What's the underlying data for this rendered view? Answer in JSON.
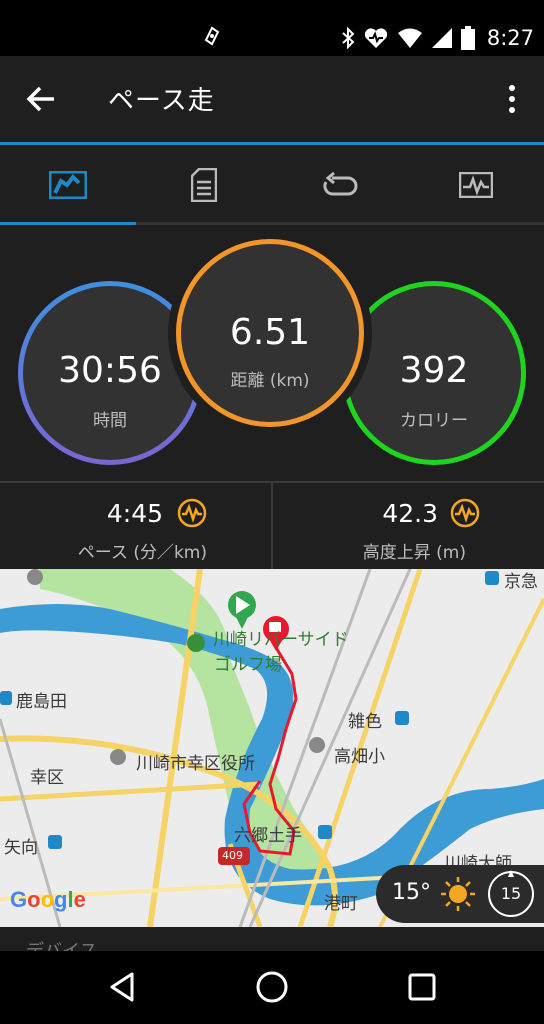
{
  "status_bar": {
    "time": "8:27",
    "icons": [
      "nfc-icon",
      "bluetooth-icon",
      "heart-monitor-icon",
      "wifi-icon",
      "cell-signal-icon",
      "battery-icon"
    ]
  },
  "app_bar": {
    "title": "ペース走",
    "back_icon": "arrow-left-icon",
    "menu_icon": "more-vert-icon"
  },
  "tabs": [
    {
      "icon": "overview-icon",
      "active": true
    },
    {
      "icon": "details-icon",
      "active": false
    },
    {
      "icon": "laps-icon",
      "active": false
    },
    {
      "icon": "charts-icon",
      "active": false
    }
  ],
  "summary": {
    "time": {
      "value": "30:56",
      "label": "時間"
    },
    "distance": {
      "value": "6.51",
      "label": "距離 (km)"
    },
    "calories": {
      "value": "392",
      "label": "カロリー"
    }
  },
  "stats": [
    {
      "value": "4:45",
      "label": "ペース (分／km)",
      "icon": "performance-icon"
    },
    {
      "value": "42.3",
      "label": "高度上昇 (m)",
      "icon": "performance-icon"
    }
  ],
  "map": {
    "labels": {
      "golf": "川崎リバーサイド",
      "golf2": "ゴルフ場",
      "kashimada": "鹿島田",
      "saiwai_ward": "川崎市幸区役所",
      "saiwaiku": "幸区",
      "zoshiki": "雑色",
      "takahata": "高畑小",
      "rokugo": "六郷土手",
      "yako": "矢向",
      "minatomachi": "港町",
      "keikyu": "京急",
      "kawasaki_daishi": "川崎大師",
      "route": "409"
    },
    "attribution": "Google",
    "weather": {
      "temp": "15°",
      "wind": "15",
      "icon": "sun-icon"
    }
  },
  "device_peek": "デバイス",
  "colors": {
    "accent": "#1e88c9",
    "distance_ring": "#f2962a",
    "calorie_ring": "#1fd41f",
    "time_ring_top": "#3f8fe0",
    "time_ring_bottom": "#7a66d1",
    "route": "#e8192c",
    "river": "#3d9bd6",
    "park": "#b5e3a0"
  },
  "nav_bar": {
    "items": [
      "back-triangle-icon",
      "home-circle-icon",
      "recents-square-icon"
    ]
  }
}
